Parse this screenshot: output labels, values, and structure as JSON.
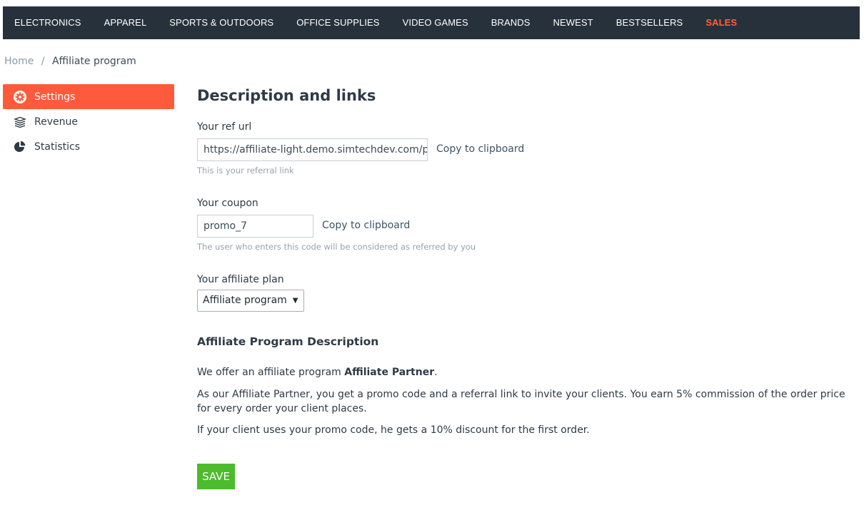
{
  "topnav": {
    "items": [
      "ELECTRONICS",
      "APPAREL",
      "SPORTS & OUTDOORS",
      "OFFICE SUPPLIES",
      "VIDEO GAMES",
      "BRANDS",
      "NEWEST",
      "BESTSELLERS",
      "SALES"
    ]
  },
  "breadcrumb": {
    "home": "Home",
    "separator": "/",
    "current": "Affiliate program"
  },
  "sidebar": {
    "items": [
      {
        "label": "Settings",
        "icon": "gear-icon",
        "active": true
      },
      {
        "label": "Revenue",
        "icon": "money-stack-icon",
        "active": false
      },
      {
        "label": "Statistics",
        "icon": "pie-chart-icon",
        "active": false
      }
    ]
  },
  "main": {
    "title": "Description and links",
    "ref_url": {
      "label": "Your ref url",
      "value": "https://affiliate-light.demo.simtechdev.com/pro",
      "copy": "Copy to clipboard",
      "hint": "This is your referral link"
    },
    "coupon": {
      "label": "Your coupon",
      "value": "promo_7",
      "copy": "Copy to clipboard",
      "hint": "The user who enters this code will be considered as referred by you"
    },
    "plan": {
      "label": "Your affiliate plan",
      "selected": "Affiliate program"
    },
    "description": {
      "heading": "Affiliate Program Description",
      "p1_prefix": "We offer an affiliate program ",
      "p1_bold": "Affiliate Partner",
      "p1_suffix": ".",
      "p2": "As our Affiliate Partner, you get a promo code and a referral link to invite your clients. You earn 5% commission of the order price for every order your client places.",
      "p3": "If your client uses your promo code, he gets a 10% discount for the first order."
    },
    "save_label": "SAVE"
  },
  "colors": {
    "nav_bg": "#27313b",
    "sales": "#ff6339",
    "active_sidebar": "#ff5a3c",
    "save_button": "#4cbb2c"
  }
}
